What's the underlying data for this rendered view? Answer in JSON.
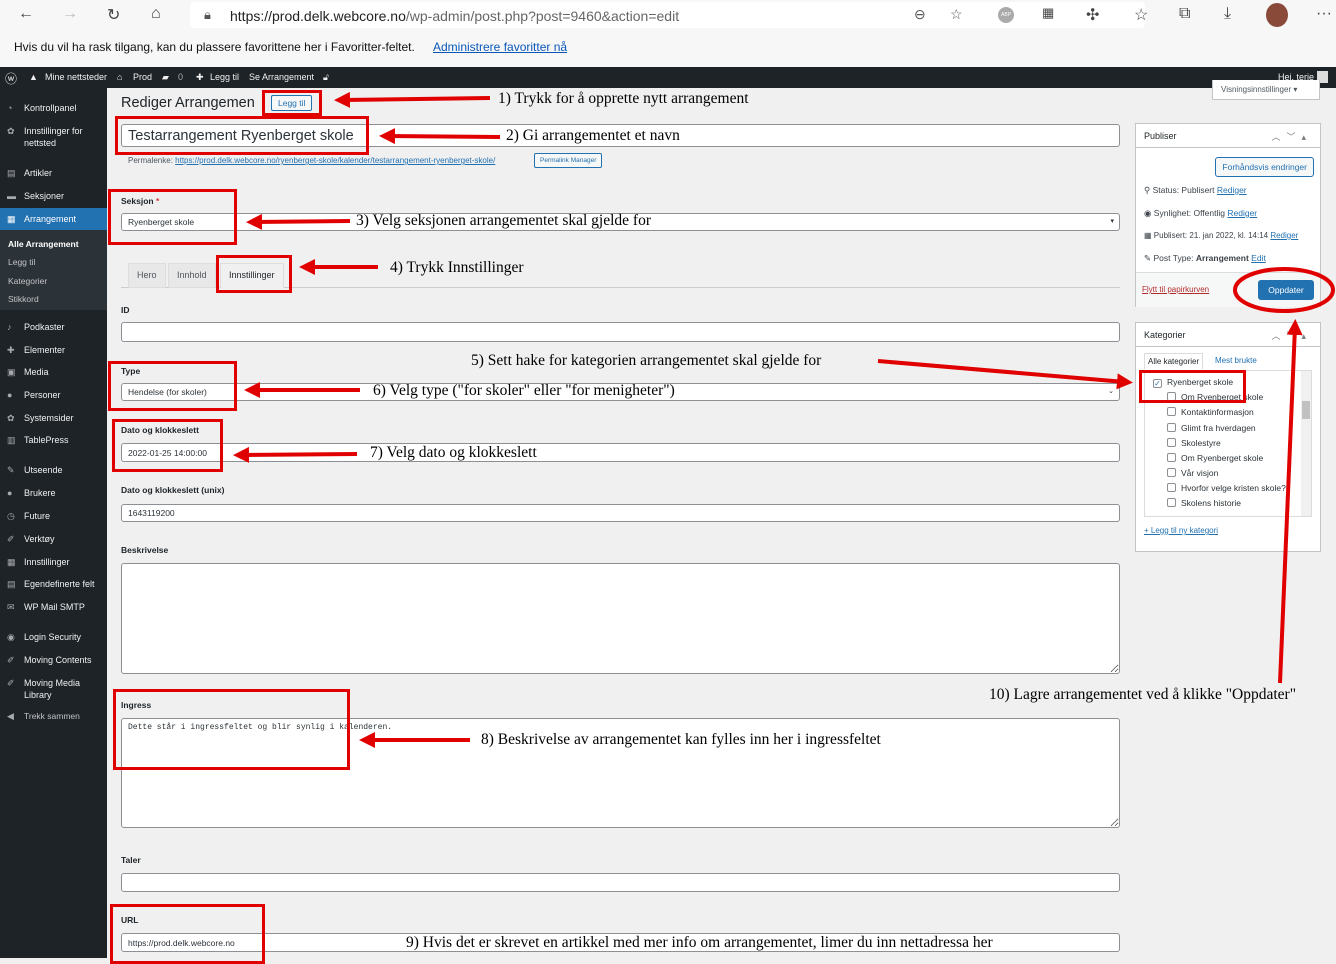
{
  "browser": {
    "url_host": "https://prod.delk.webcore.no",
    "url_path": "/wp-admin/post.php?post=9460&action=edit",
    "icons": [
      "back-icon",
      "forward-icon",
      "reload-icon",
      "home-icon",
      "lock-icon",
      "zoom-icon",
      "favorite-add-icon",
      "adblock-icon",
      "qr-icon",
      "extensions-icon",
      "favorites-icon",
      "collections-icon",
      "download-icon",
      "avatar",
      "more-icon"
    ],
    "more": "···"
  },
  "favbar": {
    "text": "Hvis du vil ha rask tilgang, kan du plassere favorittene her i Favoritter-feltet.",
    "link": "Administrere favoritter nå"
  },
  "adminbar": {
    "sites": "Mine nettsteder",
    "site": "Prod",
    "comments": "0",
    "new": "Legg til",
    "view": "Se Arrangement",
    "greeting": "Hei, terje"
  },
  "sidebar": {
    "items": [
      "Kontrollpanel",
      "Innstillinger for",
      "nettsted",
      "Artikler",
      "Seksjoner",
      "Arrangement",
      "Podkaster",
      "Elementer",
      "Media",
      "Personer",
      "Systemsider",
      "TablePress",
      "Utseende",
      "Brukere",
      "Future",
      "Verktøy",
      "Innstillinger",
      "Egendefinerte felt",
      "WP Mail SMTP",
      "Login Security",
      "Moving Contents",
      "Moving Media",
      "Library",
      "Trekk sammen"
    ],
    "submenu": [
      "Alle Arrangement",
      "Legg til",
      "Kategorier",
      "Stikkord"
    ]
  },
  "page": {
    "title": "Rediger Arrangemen",
    "add_new": "Legg til",
    "screen_options": "Visningsinnstillinger ▾",
    "post_title": "Testarrangement Ryenberget skole",
    "permalink_label": "Permalenke:",
    "permalink_url": "https://prod.delk.webcore.no/ryenberget-skole/kalender/testarrangement-ryenberget-skole/",
    "permalink_manager": "Permalink Manager"
  },
  "form": {
    "seksjon_label": "Seksjon",
    "required": "*",
    "seksjon_value": "Ryenberget skole",
    "tabs": [
      "Hero",
      "Innhold",
      "Innstillinger"
    ],
    "id_label": "ID",
    "id_value": "",
    "type_label": "Type",
    "type_value": "Hendelse (for skoler)",
    "date_label": "Dato og klokkeslett",
    "date_value": "2022-01-25 14:00:00",
    "unix_label": "Dato og klokkeslett (unix)",
    "unix_value": "1643119200",
    "desc_label": "Beskrivelse",
    "desc_value": "",
    "ingress_label": "Ingress",
    "ingress_value": "Dette står i ingressfeltet og blir synlig i kalenderen.",
    "taler_label": "Taler",
    "taler_value": "",
    "url_label": "URL",
    "url_value": "https://prod.delk.webcore.no"
  },
  "publish": {
    "title": "Publiser",
    "preview": "Forhåndsvis endringer",
    "status": "Status: Publisert",
    "visibility": "Synlighet: Offentlig",
    "published": "Publisert: 21. jan 2022, kl. 14:14",
    "edit": "Rediger",
    "post_type_label": "Post Type:",
    "post_type": "Arrangement",
    "post_type_edit": "Edit",
    "trash": "Flytt til papirkurven",
    "update": "Oppdater"
  },
  "categories": {
    "title": "Kategorier",
    "tab_all": "Alle kategorier",
    "tab_most": "Mest brukte",
    "items": [
      {
        "label": "Ryenberget skole",
        "checked": true
      },
      {
        "label": "Om Ryenberget skole",
        "checked": false
      },
      {
        "label": "Kontaktinformasjon",
        "checked": false
      },
      {
        "label": "Glimt fra hverdagen",
        "checked": false
      },
      {
        "label": "Skolestyre",
        "checked": false
      },
      {
        "label": "Om Ryenberget skole",
        "checked": false
      },
      {
        "label": "Vår visjon",
        "checked": false
      },
      {
        "label": "Hvorfor velge kristen skole?",
        "checked": false
      },
      {
        "label": "Skolens historie",
        "checked": false
      }
    ],
    "add_new": "+ Legg til ny kategori"
  },
  "annotations": [
    "1) Trykk for å opprette nytt arrangement",
    "2) Gi arrangementet et navn",
    "3) Velg seksjonen arrangementet skal gjelde for",
    "4) Trykk Innstillinger",
    "5) Sett hake for kategorien arrangementet skal gjelde for",
    "6) Velg type (\"for skoler\" eller \"for menigheter\")",
    "7) Velg dato og klokkeslett",
    "8) Beskrivelse av arrangementet kan fylles inn her i ingressfeltet",
    "9) Hvis det er skrevet en artikkel med mer info om arrangementet, limer du inn nettadressa her",
    "10) Lagre arrangementet ved å klikke \"Oppdater\""
  ],
  "colors": {
    "annotation": "#e00000",
    "wp_blue": "#2271b1",
    "admin_dark": "#1d2327"
  }
}
